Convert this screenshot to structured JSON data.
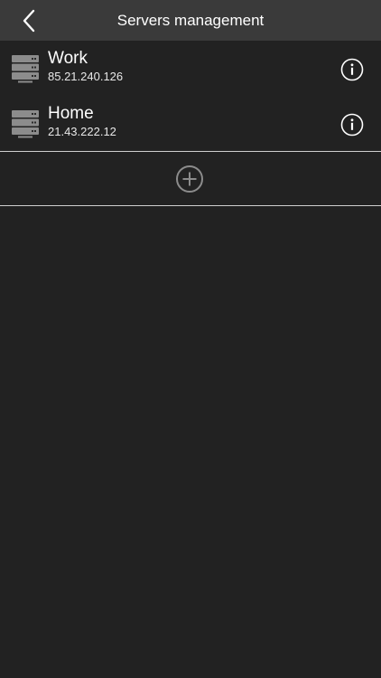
{
  "navbar": {
    "title": "Servers management",
    "back_icon": "chevron-left-icon"
  },
  "servers": [
    {
      "name": "Work",
      "ip": "85.21.240.126",
      "icon": "server-icon",
      "info_icon": "info-icon"
    },
    {
      "name": "Home",
      "ip": "21.43.222.12",
      "icon": "server-icon",
      "info_icon": "info-icon"
    }
  ],
  "add_button": {
    "icon": "add-circle-icon"
  },
  "colors": {
    "background": "#222222",
    "navbar": "#3a3a3a",
    "text": "#ffffff",
    "icon_gray": "#8c8c8c",
    "divider": "#cfcfcf"
  }
}
